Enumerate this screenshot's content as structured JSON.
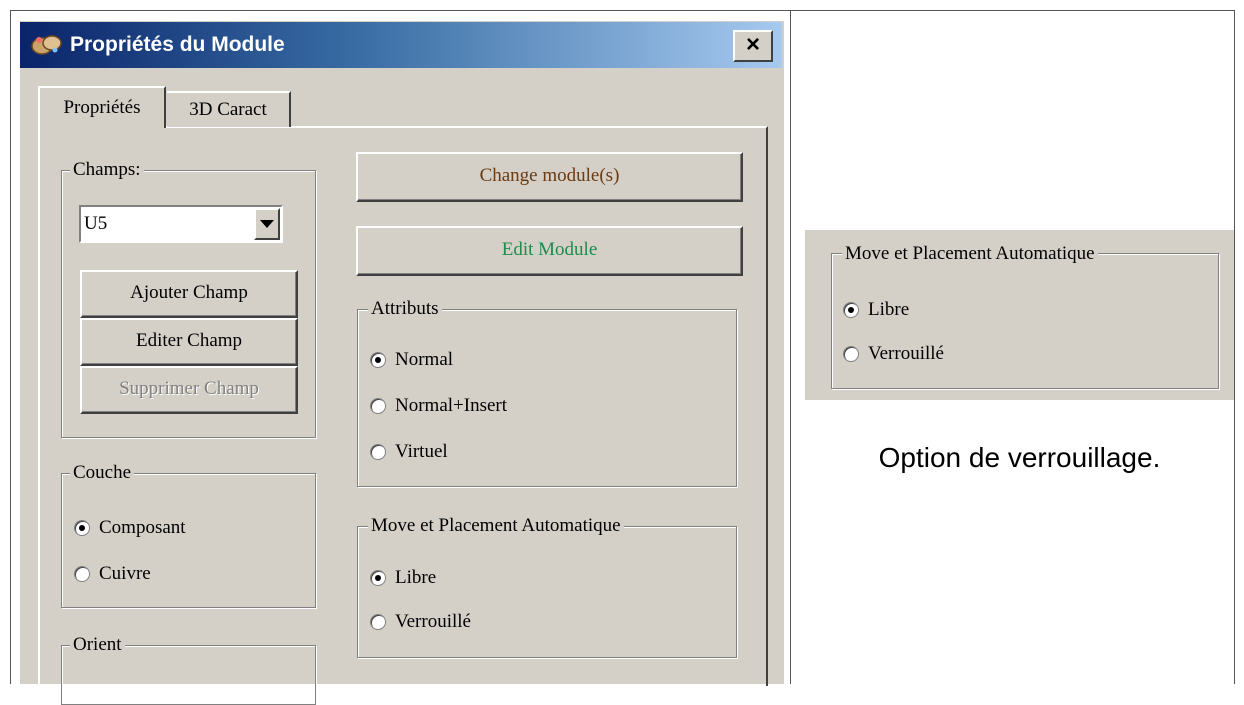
{
  "dialog": {
    "title": "Propriétés du Module",
    "close_label": "×",
    "icon": "module-app-icon",
    "tabs": [
      {
        "label": "Propriétés"
      },
      {
        "label": "3D Caract"
      }
    ]
  },
  "champs": {
    "legend": "Champs:",
    "selected": "U5",
    "add_label": "Ajouter Champ",
    "edit_label": "Editer Champ",
    "delete_label": "Supprimer Champ"
  },
  "couche": {
    "legend": "Couche",
    "options": [
      "Composant",
      "Cuivre"
    ],
    "selected": "Composant"
  },
  "orient": {
    "legend": "Orient"
  },
  "actions": {
    "change_label": "Change module(s)",
    "edit_label": "Edit Module",
    "change_color": "#6b3a10",
    "edit_color": "#1f8a4c"
  },
  "attributs": {
    "legend": "Attributs",
    "options": [
      "Normal",
      "Normal+Insert",
      "Virtuel"
    ],
    "selected": "Normal"
  },
  "move": {
    "legend": "Move et Placement Automatique",
    "options": [
      "Libre",
      "Verrouillé"
    ],
    "selected": "Libre"
  },
  "side": {
    "legend": "Move et Placement Automatique",
    "options": [
      "Libre",
      "Verrouillé"
    ],
    "selected": "Libre",
    "caption": "Option de verrouillage."
  }
}
